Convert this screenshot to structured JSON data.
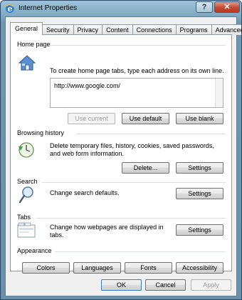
{
  "window": {
    "title": "Internet Properties"
  },
  "tabs": [
    {
      "label": "General"
    },
    {
      "label": "Security"
    },
    {
      "label": "Privacy"
    },
    {
      "label": "Content"
    },
    {
      "label": "Connections"
    },
    {
      "label": "Programs"
    },
    {
      "label": "Advanced"
    }
  ],
  "home_page": {
    "label": "Home page",
    "description": "To create home page tabs, type each address on its own line.",
    "url": "http://www.google.com/",
    "use_current": "Use current",
    "use_default": "Use default",
    "use_blank": "Use blank"
  },
  "browsing_history": {
    "label": "Browsing history",
    "description_line1": "Delete temporary files, history, cookies, saved passwords,",
    "description_line2": "and web form information.",
    "delete": "Delete...",
    "settings": "Settings"
  },
  "search": {
    "label": "Search",
    "description": "Change search defaults.",
    "settings": "Settings"
  },
  "tabs_section": {
    "label": "Tabs",
    "description_line1": "Change how webpages are displayed in",
    "description_line2": "tabs.",
    "settings": "Settings"
  },
  "appearance": {
    "label": "Appearance",
    "colors": "Colors",
    "languages": "Languages",
    "fonts": "Fonts",
    "accessibility": "Accessibility"
  },
  "footer": {
    "ok": "OK",
    "cancel": "Cancel",
    "apply": "Apply"
  }
}
